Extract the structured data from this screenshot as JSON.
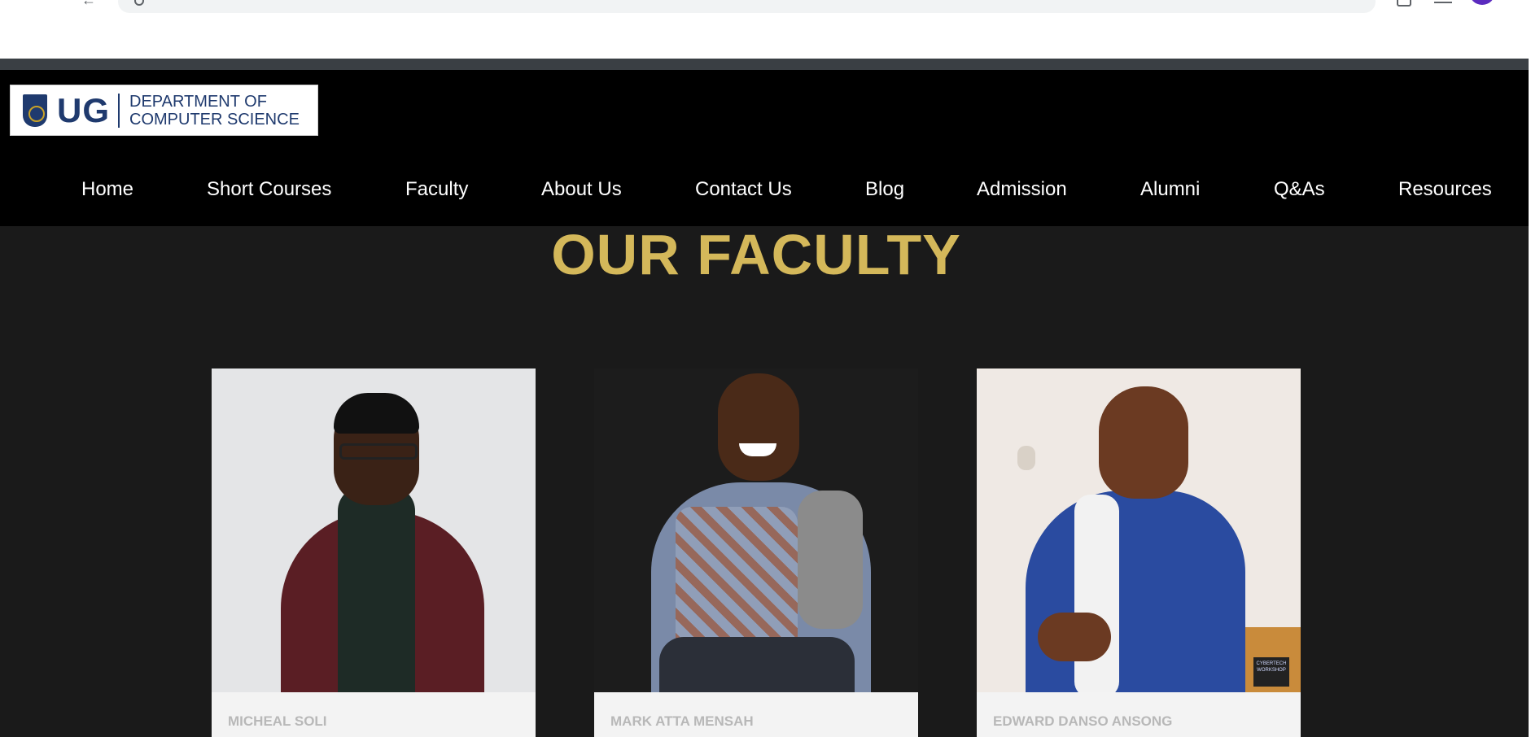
{
  "header": {
    "logo": {
      "short": "UG",
      "line1": "DEPARTMENT OF",
      "line2": "COMPUTER SCIENCE"
    },
    "nav": [
      {
        "label": "Home"
      },
      {
        "label": "Short Courses"
      },
      {
        "label": "Faculty"
      },
      {
        "label": "About Us"
      },
      {
        "label": "Contact Us"
      },
      {
        "label": "Blog"
      },
      {
        "label": "Admission"
      },
      {
        "label": "Alumni"
      },
      {
        "label": "Q&As"
      },
      {
        "label": "Resources"
      }
    ]
  },
  "main": {
    "title": "OUR FACULTY",
    "faculty": [
      {
        "name": "MICHEAL SOLI"
      },
      {
        "name": "MARK ATTA MENSAH"
      },
      {
        "name": "EDWARD DANSO ANSONG",
        "photo_badge": "CYBERTECH WORKSHOP"
      }
    ]
  },
  "colors": {
    "accent": "#d4b85a",
    "header_bg": "#000000",
    "section_bg": "#1a1a1a",
    "logo_blue": "#1f3a6e"
  }
}
